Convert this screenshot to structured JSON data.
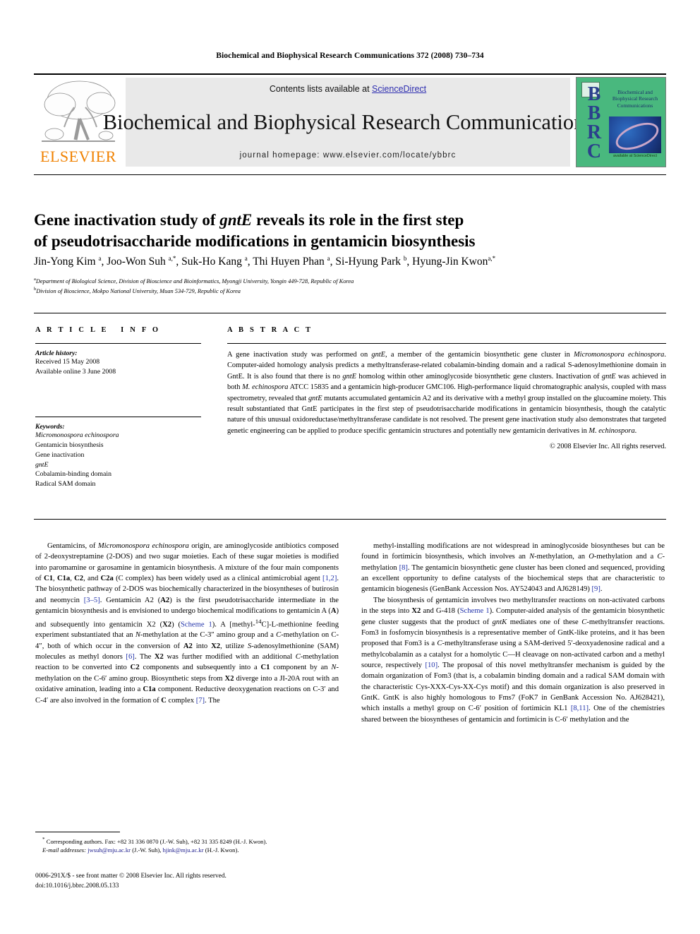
{
  "running_head": "Biochemical and Biophysical Research Communications 372 (2008) 730–734",
  "masthead": {
    "contents_prefix": "Contents lists available at ",
    "sciencedirect": "ScienceDirect",
    "journal_name": "Biochemical and Biophysical Research Communications",
    "homepage": "journal homepage: www.elsevier.com/locate/ybbrc",
    "elsevier_wordmark": "ELSEVIER",
    "elsevier_accent_color": "#F08100",
    "sciencedirect_link_color": "#2f2fb0",
    "cover": {
      "letters": "BBRC",
      "title_lines": "Biochemical and Biophysical Research Communications",
      "publisher_note": "available at ScienceDirect",
      "background_color": "#49b87e",
      "letters_color": "#2b3f8c"
    }
  },
  "article": {
    "title_line1_a": "Gene inactivation study of ",
    "title_line1_italic": "gntE",
    "title_line1_b": " reveals its role in the first step",
    "title_line2": "of pseudotrisaccharide modifications in gentamicin biosynthesis",
    "authors_html": "Jin-Yong Kim <sup>a</sup>, Joo-Won Suh <sup>a,*</sup>, Suk-Ho Kang <sup>a</sup>, Thi Huyen Phan <sup>a</sup>, Si-Hyung Park <sup>b</sup>, Hyung-Jin Kwon<sup>a,*</sup>",
    "affiliation_a": "Department of Biological Science, Division of Bioscience and Bioinformatics, Myongji University, Yongin 449-728, Republic of Korea",
    "affiliation_b": "Division of Bioscience, Mokpo National University, Muan 534-729, Republic of Korea"
  },
  "article_info": {
    "heading": "ARTICLE INFO",
    "history_label": "Article history:",
    "received": "Received 15 May 2008",
    "available_online": "Available online 3 June 2008",
    "keywords_label": "Keywords:",
    "keywords": [
      "Micromonospora echinospora",
      "Gentamicin biosynthesis",
      "Gene inactivation",
      "gntE",
      "Cobalamin-binding domain",
      "Radical SAM domain"
    ],
    "keywords_italic_index": [
      0,
      3
    ]
  },
  "abstract": {
    "heading": "ABSTRACT",
    "body_html": "A gene inactivation study was performed on <em>gntE</em>, a member of the gentamicin biosynthetic gene cluster in <em>Micromonospora echinospora</em>. Computer-aided homology analysis predicts a methyltransferase-related cobalamin-binding domain and a radical S-adenosylmethionine domain in GntE. It is also found that there is no <em>gntE</em> homolog within other aminoglycoside biosynthetic gene clusters. Inactivation of <em>gntE</em> was achieved in both <em>M. echinospora</em> ATCC 15835 and a gentamicin high-producer GMC106. High-performance liquid chromatographic analysis, coupled with mass spectrometry, revealed that <em>gntE</em> mutants accumulated gentamicin A2 and its derivative with a methyl group installed on the glucoamine moiety. This result substantiated that GntE participates in the first step of pseudotrisaccharide modifications in gentamicin biosynthesis, though the catalytic nature of this unusual oxidoreductase/methyltransferase candidate is not resolved. The present gene inactivation study also demonstrates that targeted genetic engineering can be applied to produce specific gentamicin structures and potentially new gentamicin derivatives in <em>M. echinospora</em>.",
    "copyright": "© 2008 Elsevier Inc. All rights reserved."
  },
  "body": {
    "left_column_html": "Gentamicins, of <em>Micromonospora echinospora</em> origin, are aminoglycoside antibiotics composed of 2-deoxystreptamine (2-DOS) and two sugar moieties. Each of these sugar moieties is modified into paromamine or garosamine in gentamicin biosynthesis. A mixture of the four main components of <b>C1</b>, <b>C1a</b>, <b>C2</b>, and <b>C2a</b> (C complex) has been widely used as a clinical antimicrobial agent <span class=\"ref\">[1,2]</span>. The biosynthetic pathway of 2-DOS was biochemically characterized in the biosyntheses of butirosin and neomycin <span class=\"ref\">[3–5]</span>. Gentamicin A2 (<b>A2</b>) is the first pseudotrisaccharide intermediate in the gentamicin biosynthesis and is envisioned to undergo biochemical modifications to gentamicin A (<b>A</b>) and subsequently into gentamicin X2 (<b>X2</b>) (<span class=\"ref\">Scheme 1</span>). A [methyl-<sup>14</sup>C]-<span style=\"font-variant:small-caps\">L</span>-methionine feeding experiment substantiated that an <em>N</em>-methylation at the C-3″ amino group and a <em>C</em>-methylation on C-4″, both of which occur in the conversion of <b>A2</b> into <b>X2</b>, utilize <em>S</em>-adenosylmethionine (SAM) molecules as methyl donors <span class=\"ref\">[6]</span>. The <b>X2</b> was further modified with an additional <em>C</em>-methylation reaction to be converted into <b>C2</b> components and subsequently into a <b>C1</b> component by an <em>N</em>-methylation on the C-6′ amino group. Biosynthetic steps from <b>X2</b> diverge into a JI-20A rout with an oxidative amination, leading into a <b>C1a</b> component. Reductive deoxygenation reactions on C-3′ and C-4′ are also involved in the formation of <b>C</b> complex <span class=\"ref\">[7]</span>. The",
    "right_paragraph_1_html": "methyl-installing modifications are not widespread in aminoglycoside biosyntheses but can be found in fortimicin biosynthesis, which involves an <em>N</em>-methylation, an <em>O</em>-methylation and a <em>C</em>-methylation <span class=\"ref\">[8]</span>. The gentamicin biosynthetic gene cluster has been cloned and sequenced, providing an excellent opportunity to define catalysts of the biochemical steps that are characteristic to gentamicin biogenesis (GenBank Accession Nos. AY524043 and AJ628149) <span class=\"ref\">[9]</span>.",
    "right_paragraph_2_html": "The biosynthesis of gentamicin involves two methyltransfer reactions on non-activated carbons in the steps into <b>X2</b> and G-418 (<span class=\"ref\">Scheme 1</span>). Computer-aided analysis of the gentamicin biosynthetic gene cluster suggests that the product of <em>gntK</em> mediates one of these <em>C</em>-methyltransfer reactions. Fom3 in fosfomycin biosynthesis is a representative member of GntK-like proteins, and it has been proposed that Fom3 is a <em>C</em>-methyltransferase using a SAM-derived 5′-deoxyadenosine radical and a methylcobalamin as a catalyst for a homolytic C—H cleavage on non-activated carbon and a methyl source, respectively <span class=\"ref\">[10]</span>. The proposal of this novel methyltransfer mechanism is guided by the domain organization of Fom3 (that is, a cobalamin binding domain and a radical SAM domain with the characteristic Cys-XXX-Cys-XX-Cys motif) and this domain organization is also preserved in GntK. GntK is also highly homologous to Fms7 (FoK7 in GenBank Accession No. AJ628421), which installs a methyl group on C-6′ position of fortimicin KL1 <span class=\"ref\">[8,11]</span>. One of the chemistries shared between the biosyntheses of gentamicin and fortimicin is C-6′ methylation and the"
  },
  "footnotes": {
    "corresponding_html": "<sup>*</sup> Corresponding authors. Fax: +82 31 336 0870 (J.-W. Suh), +82 31 335 8249 (H.-J. Kwon).",
    "email_html": "<span class=\"email-label\">E-mail addresses:</span> <span class=\"mail\">jwsuh@mju.ac.kr</span> (J.-W. Suh), <span class=\"mail\">hjink@mju.ac.kr</span> (H.-J. Kwon)."
  },
  "footer": {
    "issn_line": "0006-291X/$ - see front matter © 2008 Elsevier Inc. All rights reserved.",
    "doi_line": "doi:10.1016/j.bbrc.2008.05.133"
  }
}
